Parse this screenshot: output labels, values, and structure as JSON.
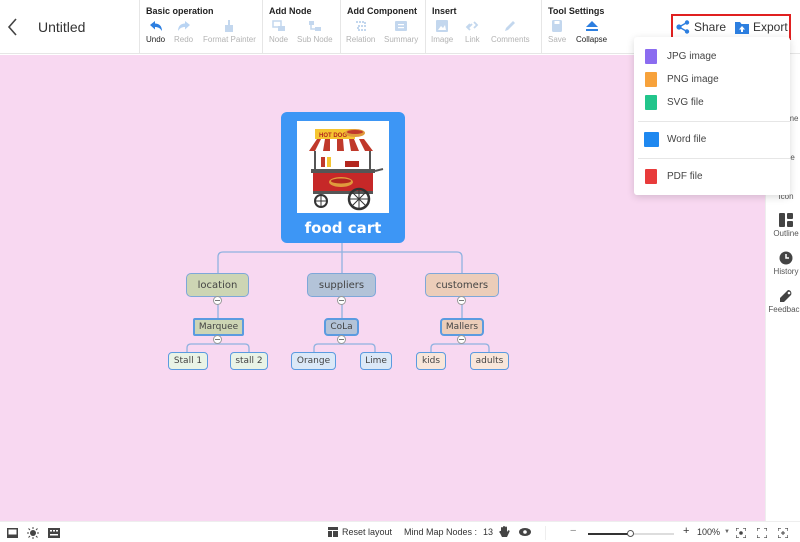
{
  "header": {
    "title": "Untitled",
    "groups": [
      {
        "title": "Basic operation",
        "tools": [
          {
            "label": "Undo",
            "icon": "undo-icon",
            "active": true
          },
          {
            "label": "Redo",
            "icon": "redo-icon",
            "active": false
          },
          {
            "label": "Format Painter",
            "icon": "format-painter-icon",
            "active": false
          }
        ]
      },
      {
        "title": "Add Node",
        "tools": [
          {
            "label": "Node",
            "icon": "node-icon",
            "active": false
          },
          {
            "label": "Sub Node",
            "icon": "sub-node-icon",
            "active": false
          }
        ]
      },
      {
        "title": "Add Component",
        "tools": [
          {
            "label": "Relation",
            "icon": "relation-icon",
            "active": false
          },
          {
            "label": "Summary",
            "icon": "summary-icon",
            "active": false
          }
        ]
      },
      {
        "title": "Insert",
        "tools": [
          {
            "label": "Image",
            "icon": "image-icon",
            "active": false
          },
          {
            "label": "Link",
            "icon": "link-icon",
            "active": false
          },
          {
            "label": "Comments",
            "icon": "comments-icon",
            "active": false
          }
        ]
      },
      {
        "title": "Tool Settings",
        "tools": [
          {
            "label": "Save",
            "icon": "save-icon",
            "active": false
          },
          {
            "label": "Collapse",
            "icon": "collapse-icon",
            "active": true
          }
        ]
      }
    ],
    "share_label": "Share",
    "export_label": "Export"
  },
  "export_menu": {
    "items": [
      {
        "label": "JPG image",
        "icon": "jpg-file-icon",
        "color": "#8b6cf0"
      },
      {
        "label": "PNG image",
        "icon": "png-file-icon",
        "color": "#f7a23b"
      },
      {
        "label": "SVG file",
        "icon": "svg-file-icon",
        "color": "#22c58b"
      },
      {
        "label": "Word file",
        "icon": "word-file-icon",
        "color": "#1e88f0"
      },
      {
        "label": "PDF file",
        "icon": "pdf-file-icon",
        "color": "#e83b3b"
      }
    ]
  },
  "right_sidebar": {
    "items": [
      {
        "label": "Theme",
        "icon": "theme-icon"
      },
      {
        "label": "Style",
        "icon": "style-icon"
      },
      {
        "label": "Icon",
        "icon": "icon-icon"
      },
      {
        "label": "Outline",
        "icon": "outline-icon"
      },
      {
        "label": "History",
        "icon": "history-icon"
      },
      {
        "label": "Feedback",
        "icon": "feedback-icon"
      }
    ]
  },
  "mindmap": {
    "root": {
      "label": "food cart",
      "image": "hot-dog-cart-image",
      "image_sign": "HOT DOG",
      "color": "#3d96f5"
    },
    "branches": [
      {
        "label": "location",
        "color": "#cdd5b4",
        "child": {
          "label": "Marquee",
          "color": "#cdd5b4",
          "leaves": [
            "Stall 1",
            "stall 2"
          ],
          "leaf_color": "#e9f3e6"
        }
      },
      {
        "label": "suppliers",
        "color": "#b3c3d8",
        "child": {
          "label": "CoLa",
          "color": "#b3c3d8",
          "leaves": [
            "Orange",
            "Lime"
          ],
          "leaf_color": "#dbe8f7"
        }
      },
      {
        "label": "customers",
        "color": "#eccdb9",
        "child": {
          "label": "Mallers",
          "color": "#eccdb9",
          "leaves": [
            "kids",
            "adults"
          ],
          "leaf_color": "#f8e6da"
        }
      }
    ]
  },
  "statusbar": {
    "reset_layout": "Reset layout",
    "nodes_label": "Mind Map Nodes :",
    "nodes_count": "13",
    "zoom_minus": "−",
    "zoom_plus": "+",
    "zoom_level": "100%",
    "zoom_slider_fraction": 0.5
  },
  "colors": {
    "canvas": "#f8d8f1",
    "accent": "#3d96f5",
    "highlight_border": "#e02020"
  }
}
